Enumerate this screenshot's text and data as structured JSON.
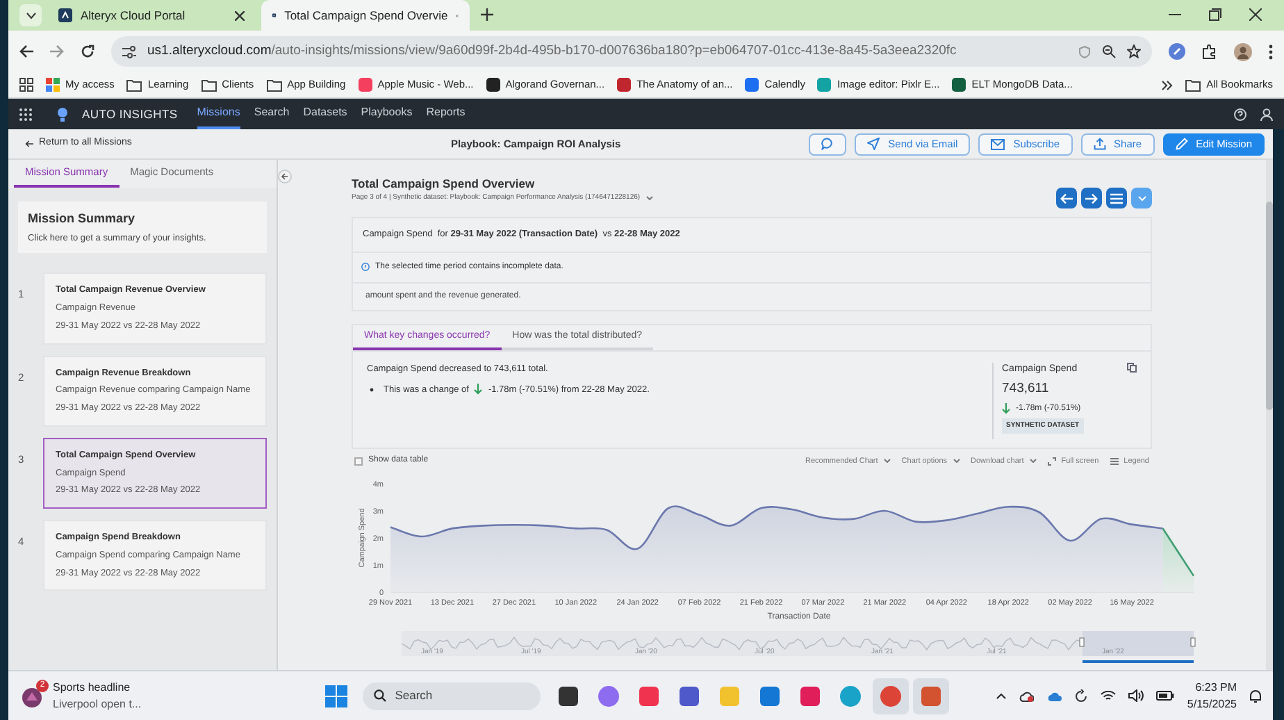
{
  "browser": {
    "tabs": [
      {
        "title": "Alteryx Cloud Portal",
        "selected": false
      },
      {
        "title": "Total Campaign Spend Overvie",
        "selected": true
      }
    ],
    "address": {
      "host": "us1.alteryxcloud.com",
      "path": "/auto-insights/missions/view/9a60d99f-2b4d-495b-b170-d007636ba180?p=eb064707-01cc-413e-8a45-5a3eea2320fc"
    },
    "bookmarks": [
      {
        "label": "My access",
        "kind": "apps"
      },
      {
        "label": "Learning",
        "kind": "folder"
      },
      {
        "label": "Clients",
        "kind": "folder"
      },
      {
        "label": "App Building",
        "kind": "folder"
      },
      {
        "label": "Apple Music - Web...",
        "kind": "site",
        "color": "#f43f5e"
      },
      {
        "label": "Algorand Governan...",
        "kind": "site",
        "color": "#222222"
      },
      {
        "label": "The Anatomy of an...",
        "kind": "site",
        "color": "#c0262d"
      },
      {
        "label": "Calendly",
        "kind": "site",
        "color": "#1d6ff2"
      },
      {
        "label": "Image editor: Pixlr E...",
        "kind": "site",
        "color": "#14a3a3"
      },
      {
        "label": "ELT MongoDB Data...",
        "kind": "site",
        "color": "#136040"
      }
    ],
    "all_bookmarks": "All Bookmarks"
  },
  "app_nav": {
    "brand": "AUTO INSIGHTS",
    "items": [
      {
        "label": "Missions",
        "selected": true
      },
      {
        "label": "Search",
        "selected": false
      },
      {
        "label": "Datasets",
        "selected": false
      },
      {
        "label": "Playbooks",
        "selected": false
      },
      {
        "label": "Reports",
        "selected": false
      }
    ]
  },
  "header": {
    "back_link": "Return to all Missions",
    "title": "Playbook: Campaign ROI Analysis",
    "buttons": [
      {
        "kind": "comment"
      },
      {
        "kind": "email",
        "label": "Send via Email"
      },
      {
        "kind": "subscribe",
        "label": "Subscribe"
      },
      {
        "kind": "share",
        "label": "Share"
      },
      {
        "kind": "edit",
        "label": "Edit Mission"
      }
    ]
  },
  "sidebar": {
    "tabs": [
      {
        "label": "Mission Summary",
        "selected": true
      },
      {
        "label": "Magic Documents",
        "selected": false
      }
    ],
    "summary": {
      "title": "Mission Summary",
      "subtitle": "Click here to get a summary of your insights."
    },
    "missions": [
      {
        "number": "1",
        "title": "Total Campaign Revenue Overview",
        "metric": "Campaign Revenue",
        "dates": "29-31 May 2022 vs 22-28 May 2022",
        "selected": false
      },
      {
        "number": "2",
        "title": "Campaign Revenue Breakdown",
        "metric": "Campaign Revenue comparing Campaign Name",
        "dates": "29-31 May 2022 vs 22-28 May 2022",
        "selected": false
      },
      {
        "number": "3",
        "title": "Total Campaign Spend Overview",
        "metric": "Campaign Spend",
        "dates": "29-31 May 2022 vs 22-28 May 2022",
        "selected": true
      },
      {
        "number": "4",
        "title": "Campaign Spend Breakdown",
        "metric": "Campaign Spend comparing Campaign Name",
        "dates": "29-31 May 2022 vs 22-28 May 2022",
        "selected": false
      }
    ]
  },
  "insight": {
    "title": "Total Campaign Spend Overview",
    "subtitle": "Page 3 of 4 | Synthetic dataset: Playbook: Campaign Performance Analysis (1746471228126)",
    "nav_buttons": [
      {
        "kind": "prev"
      },
      {
        "kind": "next"
      },
      {
        "kind": "menu"
      },
      {
        "kind": "dropdown"
      }
    ]
  },
  "period": {
    "summary": "Campaign Spend  for **29-31 May 2022 (Transaction Date)**  vs **22-28 May 2022**",
    "notice": "The selected time period contains incomplete data.",
    "overflow_text": "amount spent and the revenue generated."
  },
  "question_tabs": [
    {
      "label": "What key changes occurred?",
      "selected": true
    },
    {
      "label": "How was the total distributed?",
      "selected": false
    }
  ],
  "findings": {
    "headline": "Campaign Spend decreased to 743,611 total.",
    "change": {
      "prefix": "This was a change of",
      "delta": "-1.78m (-70.51%) from 22-28 May 2022."
    }
  },
  "kpi": {
    "label": "Campaign Spend",
    "value": "743,611",
    "delta": "-1.78m (-70.51%)",
    "badge": "SYNTHETIC DATASET"
  },
  "chart_toolbar": {
    "show_table": {
      "label": "Show data table",
      "checked": false
    },
    "menus": [
      {
        "label": "Recommended Chart",
        "kind": "dropdown"
      },
      {
        "label": "Chart options",
        "kind": "dropdown"
      },
      {
        "label": "Download chart",
        "kind": "dropdown"
      },
      {
        "label": "Full screen",
        "kind": "fullscreen"
      },
      {
        "label": "Legend",
        "kind": "legend"
      }
    ]
  },
  "chart": {
    "chart_data": {
      "type": "area",
      "xlabel": "Transaction Date",
      "ylabel": "Campaign Spend",
      "categories": [
        "29 Nov 2021",
        null,
        "13 Dec 2021",
        null,
        "27 Dec 2021",
        null,
        "10 Jan 2022",
        null,
        "24 Jan 2022",
        null,
        "07 Feb 2022",
        null,
        "21 Feb 2022",
        null,
        "07 Mar 2022",
        null,
        "21 Mar 2022",
        null,
        "04 Apr 2022",
        null,
        "18 Apr 2022",
        null,
        "02 May 2022",
        null,
        "16 May 2022",
        null,
        null
      ],
      "series": [
        {
          "color": "#6b78ad",
          "values": [
            2400000,
            2050000,
            2350000,
            2450000,
            2480000,
            2450000,
            2350000,
            2300000,
            1600000,
            3100000,
            2850000,
            2450000,
            3100000,
            3050000,
            2750000,
            2700000,
            3000000,
            2600000,
            2650000,
            2900000,
            3150000,
            2950000,
            1900000,
            2700000,
            2500000,
            2350000,
            null
          ]
        },
        {
          "color": "#3f9e72",
          "values": [
            null,
            null,
            null,
            null,
            null,
            null,
            null,
            null,
            null,
            null,
            null,
            null,
            null,
            null,
            null,
            null,
            null,
            null,
            null,
            null,
            null,
            null,
            null,
            null,
            null,
            2350000,
            600000
          ]
        }
      ],
      "yticks": [
        {
          "value": 0,
          "label": "0"
        },
        {
          "value": 1000000,
          "label": "1m"
        },
        {
          "value": 2000000,
          "label": "2m"
        },
        {
          "value": 3000000,
          "label": "3m"
        },
        {
          "value": 4000000,
          "label": "4m"
        }
      ],
      "ylim": [
        0,
        4000000
      ]
    },
    "navigator_labels": [
      "Jan '19",
      "Jul '19",
      "Jan '20",
      "Jul '20",
      "Jan '21",
      "Jul '21",
      "Jan '22"
    ]
  },
  "taskbar": {
    "news": {
      "title": "Sports headline",
      "subtitle": "Liverpool open t...",
      "badge": "2"
    },
    "search": "Search",
    "apps": [
      {
        "kind": "taskview",
        "active": false
      },
      {
        "kind": "copilot",
        "active": false
      },
      {
        "kind": "music",
        "active": false
      },
      {
        "kind": "teams",
        "active": false
      },
      {
        "kind": "files",
        "active": false
      },
      {
        "kind": "outlook",
        "active": false
      },
      {
        "kind": "slack",
        "active": false
      },
      {
        "kind": "edge",
        "active": false
      },
      {
        "kind": "chrome",
        "active": true
      },
      {
        "kind": "powerpoint",
        "active": true
      }
    ],
    "clock": {
      "time": "6:23 PM",
      "date": "5/15/2025"
    }
  }
}
